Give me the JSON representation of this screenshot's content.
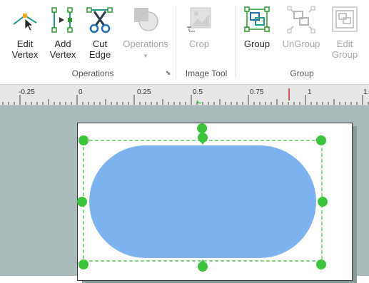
{
  "ribbon": {
    "buttons": [
      {
        "id": "edit-vertex",
        "label": "Edit\nVertex",
        "icon": "edit-vertex-icon",
        "enabled": true
      },
      {
        "id": "add-vertex",
        "label": "Add\nVertex",
        "icon": "add-vertex-icon",
        "enabled": true
      },
      {
        "id": "cut-edge",
        "label": "Cut\nEdge",
        "icon": "scissors-icon",
        "enabled": true
      },
      {
        "id": "operations",
        "label": "Operations",
        "icon": "pie-operations-icon",
        "enabled": false
      },
      {
        "id": "crop",
        "label": "Crop",
        "icon": "crop-icon",
        "enabled": false
      },
      {
        "id": "group",
        "label": "Group",
        "icon": "group-icon",
        "enabled": true
      },
      {
        "id": "ungroup",
        "label": "UnGroup",
        "icon": "ungroup-icon",
        "enabled": false
      },
      {
        "id": "edit-group",
        "label": "Edit\nGroup",
        "icon": "edit-group-icon",
        "enabled": false
      }
    ],
    "groups": [
      {
        "label": "Operations"
      },
      {
        "label": "Image Tool"
      },
      {
        "label": "Group"
      }
    ]
  },
  "ruler": {
    "labels": [
      "-0.25",
      "0",
      "0.25",
      "0.5",
      "0.75",
      "1",
      "1."
    ]
  },
  "canvas": {
    "shape": {
      "type": "rounded-rectangle",
      "fill": "#7db3ee"
    },
    "selection_color": "#3cc43c",
    "handle_color": "#3cc43c"
  },
  "colors": {
    "accent": "#1f9b8a",
    "disabled": "#a8a8a8",
    "ruler_marker": "#d9262c"
  }
}
